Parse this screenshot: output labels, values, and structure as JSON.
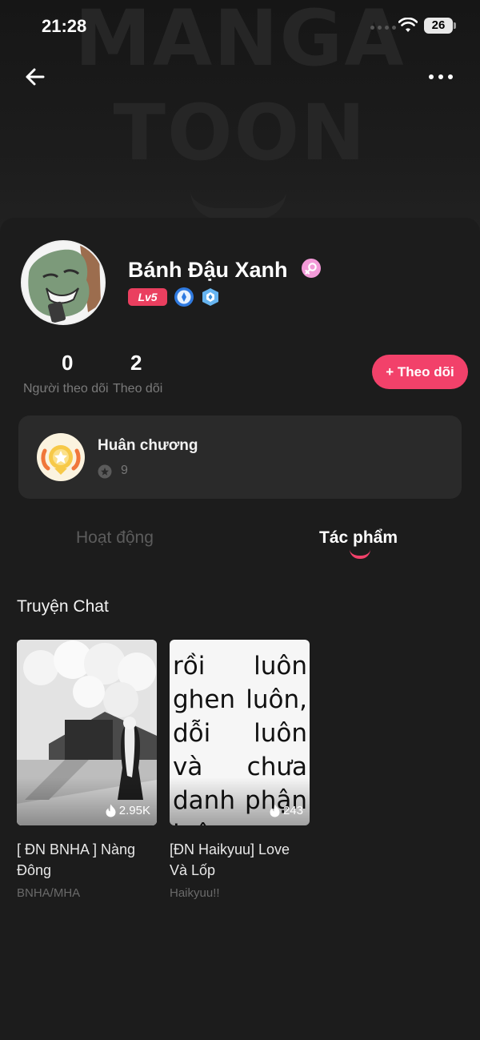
{
  "status_bar": {
    "time": "21:28",
    "battery": "26"
  },
  "banner": {
    "logo_line_1": "MANGA",
    "logo_line_2": "TOON"
  },
  "profile": {
    "name": "Bánh Đậu Xanh",
    "level": "Lv5",
    "followers_count": "0",
    "followers_label": "Người theo dõi",
    "following_count": "2",
    "following_label": "Theo dõi",
    "follow_button_label": "+ Theo dõi"
  },
  "medals": {
    "title": "Huân chương",
    "count": "9"
  },
  "tabs": [
    {
      "label": "Hoạt động",
      "active": false
    },
    {
      "label": "Tác phẩm",
      "active": true
    }
  ],
  "section": {
    "title": "Truyện Chat"
  },
  "stories": [
    {
      "title": "[ ĐN BNHA ] Nàng Đông",
      "genre": "BNHA/MHA",
      "views": "2.95K"
    },
    {
      "title": "[ĐN Haikyuu] Love Và Lốp",
      "genre": "Haikyuu!!",
      "views": "243",
      "cover_text": "rồi luôn ghen luôn, dỗi luôn và chưa danh phận luôn"
    }
  ],
  "colors": {
    "accent": "#f2416a",
    "background": "#181818",
    "card": "#2a2a2a"
  },
  "icons": [
    "back-arrow-icon",
    "more-icon",
    "wifi-icon",
    "gender-female-icon",
    "medal-icon",
    "flame-icon"
  ]
}
